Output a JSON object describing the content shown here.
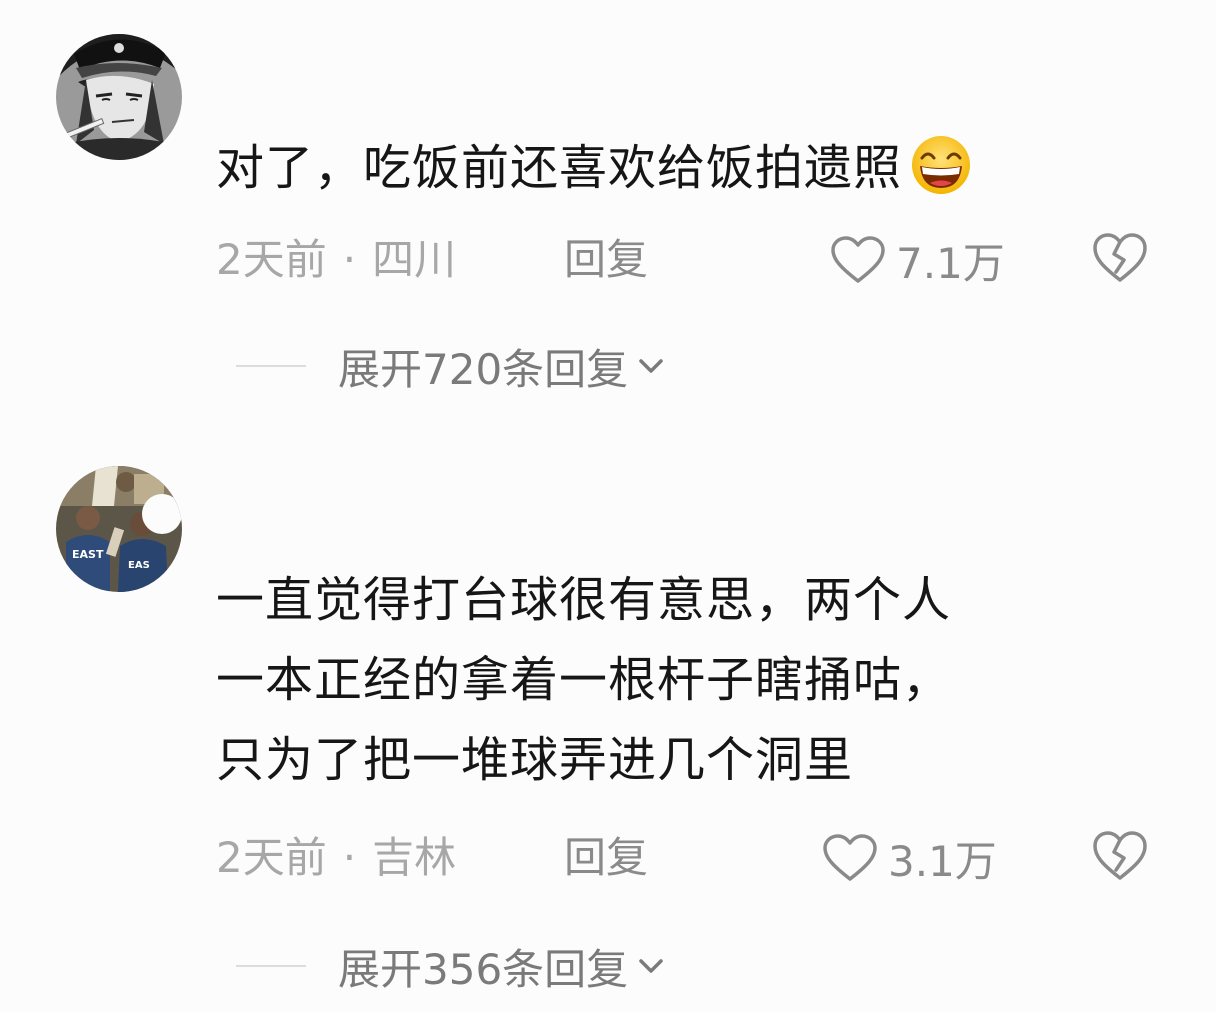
{
  "comments": [
    {
      "avatar_icon": "anime-boy-avatar",
      "text": "对了，吃饭前还喜欢给饭拍遗照",
      "emoji_icon": "grinning-squint-emoji",
      "time": "2天前",
      "separator": "·",
      "location": "四川",
      "reply_label": "回复",
      "like_count": "7.1万",
      "expand_label": "展开720条回复"
    },
    {
      "avatar_icon": "basketball-players-avatar",
      "text": "一直觉得打台球很有意思，两个人\n一本正经的拿着一根杆子瞎捅咕，\n只为了把一堆球弄进几个洞里",
      "time": "2天前",
      "separator": "·",
      "location": "吉林",
      "reply_label": "回复",
      "like_count": "3.1万",
      "expand_label": "展开356条回复"
    }
  ],
  "colors": {
    "text": "#161616",
    "meta": "#a7a7a7",
    "action": "#8a8a8a",
    "background": "#fcfcfc"
  }
}
